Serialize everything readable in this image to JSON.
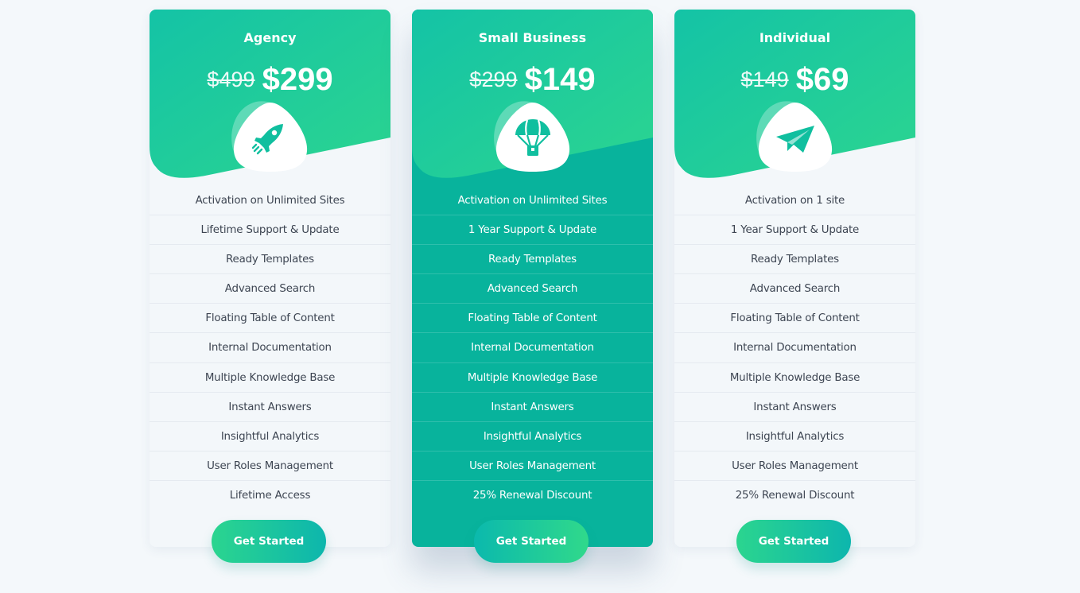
{
  "plans": [
    {
      "name": "Agency",
      "old_price": "$499",
      "price": "$299",
      "icon": "rocket-icon",
      "features": [
        "Activation on Unlimited Sites",
        "Lifetime Support & Update",
        "Ready Templates",
        "Advanced Search",
        "Floating Table of Content",
        "Internal Documentation",
        "Multiple Knowledge Base",
        "Instant Answers",
        "Insightful Analytics",
        "User Roles Management",
        "Lifetime Access"
      ],
      "cta": "Get Started"
    },
    {
      "name": "Small Business",
      "old_price": "$299",
      "price": "$149",
      "icon": "parachute-icon",
      "featured": true,
      "features": [
        "Activation on Unlimited Sites",
        "1 Year Support & Update",
        "Ready Templates",
        "Advanced Search",
        "Floating Table of Content",
        "Internal Documentation",
        "Multiple Knowledge Base",
        "Instant Answers",
        "Insightful Analytics",
        "User Roles Management",
        "25% Renewal Discount"
      ],
      "cta": "Get Started"
    },
    {
      "name": "Individual",
      "old_price": "$149",
      "price": "$69",
      "icon": "paper-plane-icon",
      "features": [
        "Activation on 1 site",
        "1 Year Support & Update",
        "Ready Templates",
        "Advanced Search",
        "Floating Table of Content",
        "Internal Documentation",
        "Multiple Knowledge Base",
        "Instant Answers",
        "Insightful Analytics",
        "User Roles Management",
        "25% Renewal Discount"
      ],
      "cta": "Get Started"
    }
  ],
  "colors": {
    "page_bg": "#f4f8fb",
    "accent_light": "#2dd68f",
    "accent_dark": "#08b39c",
    "card_bg": "#f3f7fa",
    "feature_text": "#3d4552"
  }
}
